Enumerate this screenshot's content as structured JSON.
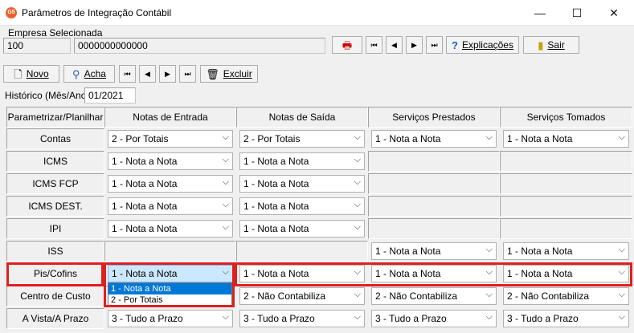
{
  "window": {
    "title": "Parâmetros de Integração Contábil",
    "app_icon_text": "G5",
    "minimize_glyph": "—",
    "maximize_glyph": "☐",
    "close_glyph": "✕"
  },
  "empresa": {
    "label": "Empresa Selecionada",
    "code": "100",
    "cnpj": "0000000000000"
  },
  "top_toolbar": {
    "explicacoes": "Explicações",
    "sair": "Sair"
  },
  "toolbar": {
    "novo": "Novo",
    "acha": "Acha",
    "excluir": "Excluir"
  },
  "historico": {
    "label": "Histórico (Mês/Ano)",
    "value": "01/2021"
  },
  "table": {
    "headers": [
      "Parametrizar/Planilhar",
      "Notas de Entrada",
      "Notas de Saída",
      "Serviços Prestados",
      "Serviços Tomados"
    ],
    "rows": [
      {
        "label": "Contas",
        "cells": [
          "2 - Por Totais",
          "2 - Por Totais",
          "1 - Nota a Nota",
          "1 - Nota a Nota"
        ]
      },
      {
        "label": "ICMS",
        "cells": [
          "1 - Nota a Nota",
          "1 - Nota a Nota",
          "",
          ""
        ]
      },
      {
        "label": "ICMS FCP",
        "cells": [
          "1 - Nota a Nota",
          "1 - Nota a Nota",
          "",
          ""
        ]
      },
      {
        "label": "ICMS DEST.",
        "cells": [
          "1 - Nota a Nota",
          "1 - Nota a Nota",
          "",
          ""
        ]
      },
      {
        "label": "IPI",
        "cells": [
          "1 - Nota a Nota",
          "1 - Nota a Nota",
          "",
          ""
        ]
      },
      {
        "label": "ISS",
        "cells": [
          "",
          "",
          "1 - Nota a Nota",
          "1 - Nota a Nota"
        ]
      },
      {
        "label": "Pis/Cofins",
        "cells": [
          "1 - Nota a Nota",
          "1 - Nota a Nota",
          "1 - Nota a Nota",
          "1 - Nota a Nota"
        ]
      },
      {
        "label": "Centro de Custo",
        "cells": [
          "",
          "2 - Não Contabiliza",
          "2 - Não Contabiliza",
          "2 - Não Contabiliza"
        ]
      },
      {
        "label": "A Vista/A Prazo",
        "cells": [
          "3 - Tudo a Prazo",
          "3 - Tudo a Prazo",
          "3 - Tudo a Prazo",
          "3 - Tudo a Prazo"
        ]
      }
    ]
  },
  "dropdown_options": [
    "1 - Nota a Nota",
    "2 - Por Totais"
  ],
  "colors": {
    "highlight_border": "#e0201e",
    "selection": "#0078d7",
    "focused_combo": "#cce8ff"
  }
}
